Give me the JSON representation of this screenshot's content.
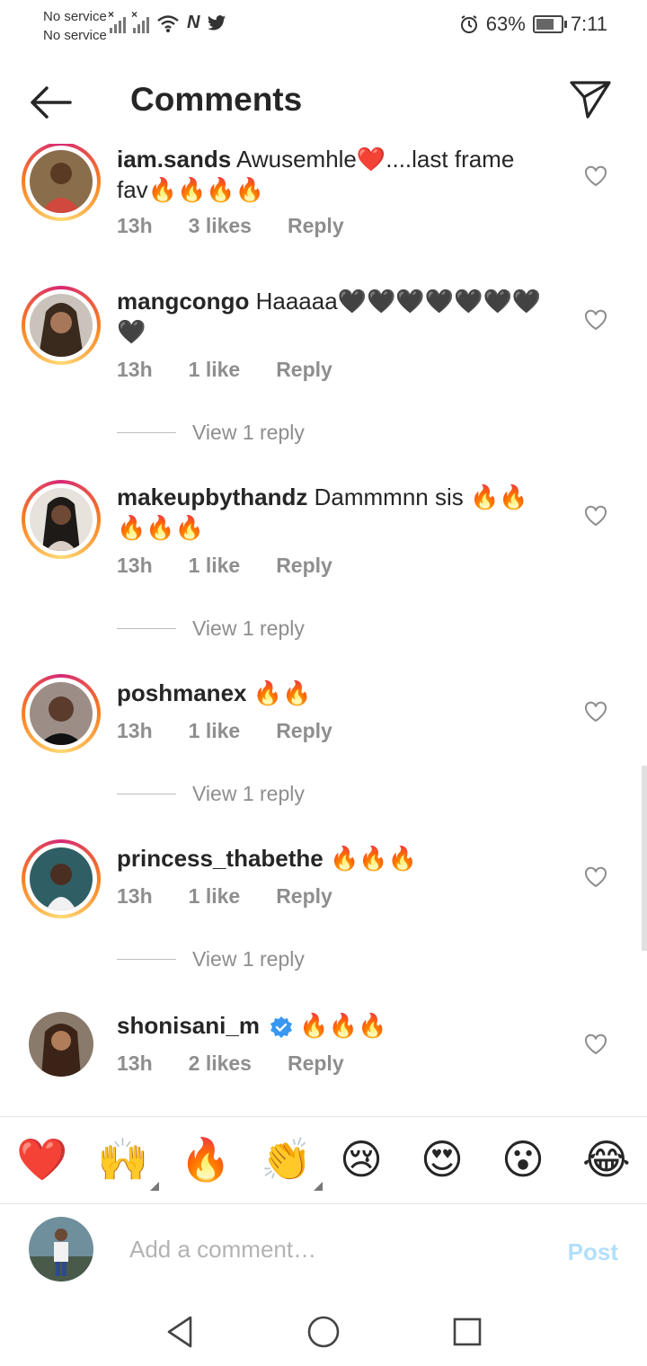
{
  "status_bar": {
    "carrier_1": "No service",
    "carrier_2": "No service",
    "battery_percent": "63%",
    "time": "7:11",
    "nfc_label": "N"
  },
  "header": {
    "title": "Comments"
  },
  "comments": [
    {
      "username": "iam.sands",
      "text": "Awusemhle❤️....last frame fav🔥🔥🔥🔥",
      "time": "13h",
      "likes": "3 likes",
      "reply": "Reply"
    },
    {
      "username": "mangcongo",
      "text": "Haaaaa🖤🖤🖤🖤🖤🖤🖤🖤",
      "time": "13h",
      "likes": "1 like",
      "reply": "Reply",
      "view_replies": "View 1 reply"
    },
    {
      "username": "makeupbythandz",
      "text": "Dammmnn sis 🔥🔥🔥🔥🔥",
      "time": "13h",
      "likes": "1 like",
      "reply": "Reply",
      "view_replies": "View 1 reply"
    },
    {
      "username": "poshmanex",
      "text": "🔥🔥",
      "time": "13h",
      "likes": "1 like",
      "reply": "Reply",
      "view_replies": "View 1 reply"
    },
    {
      "username": "princess_thabethe",
      "text": "🔥🔥🔥",
      "time": "13h",
      "likes": "1 like",
      "reply": "Reply",
      "view_replies": "View 1 reply"
    },
    {
      "username": "shonisani_m",
      "text": "🔥🔥🔥",
      "time": "13h",
      "likes": "2 likes",
      "reply": "Reply",
      "verified": true
    }
  ],
  "reactions": [
    "❤️",
    "🙌",
    "🔥",
    "👏",
    "😢",
    "😍",
    "😮",
    "😂"
  ],
  "composer": {
    "placeholder": "Add a comment…",
    "post_label": "Post"
  },
  "colors": {
    "text": "#262626",
    "meta": "#8e8e8e",
    "post_disabled": "#b2dffc",
    "verified_blue": "#3897f0"
  }
}
